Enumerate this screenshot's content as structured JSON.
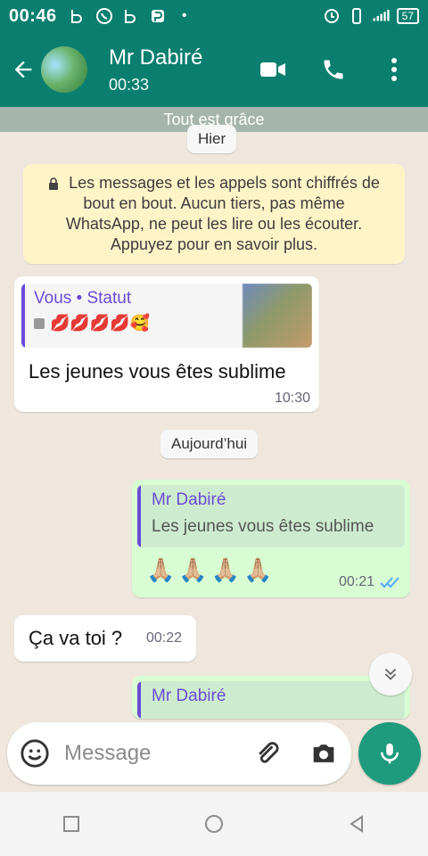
{
  "status_bar": {
    "time": "00:46",
    "battery": "57"
  },
  "header": {
    "contact_name": "Mr Dabiré",
    "last_seen": "00:33"
  },
  "banner": {
    "text": "Tout est grâce"
  },
  "chat": {
    "date_chips": {
      "yesterday": "Hier",
      "today": "Aujourd’hui"
    },
    "notice": "Les messages et les appels sont chiffrés de bout en bout. Aucun tiers, pas même WhatsApp, ne peut les lire ou les écouter. Appuyez pour en savoir plus.",
    "messages": [
      {
        "direction": "incoming",
        "reply_to": {
          "title": "Vous • Statut",
          "subtitle": "💋💋💋💋🥰"
        },
        "text": "Les jeunes vous êtes sublime",
        "time": "10:30"
      },
      {
        "direction": "outgoing",
        "reply_to": {
          "title": "Mr Dabiré",
          "subtitle": "Les jeunes vous êtes sublime"
        },
        "text": "🙏🏼🙏🏼🙏🏼🙏🏼",
        "time": "00:21"
      },
      {
        "direction": "incoming",
        "text": "Ça va toi ?",
        "time": "00:22"
      },
      {
        "direction": "outgoing",
        "reply_to": {
          "title": "Mr Dabiré"
        }
      }
    ]
  },
  "composer": {
    "placeholder": "Message"
  },
  "colors": {
    "primary": "#0a7f6f",
    "accent": "#1e9a7c",
    "incoming_bubble": "#ffffff",
    "outgoing_bubble": "#d9fdd3"
  }
}
